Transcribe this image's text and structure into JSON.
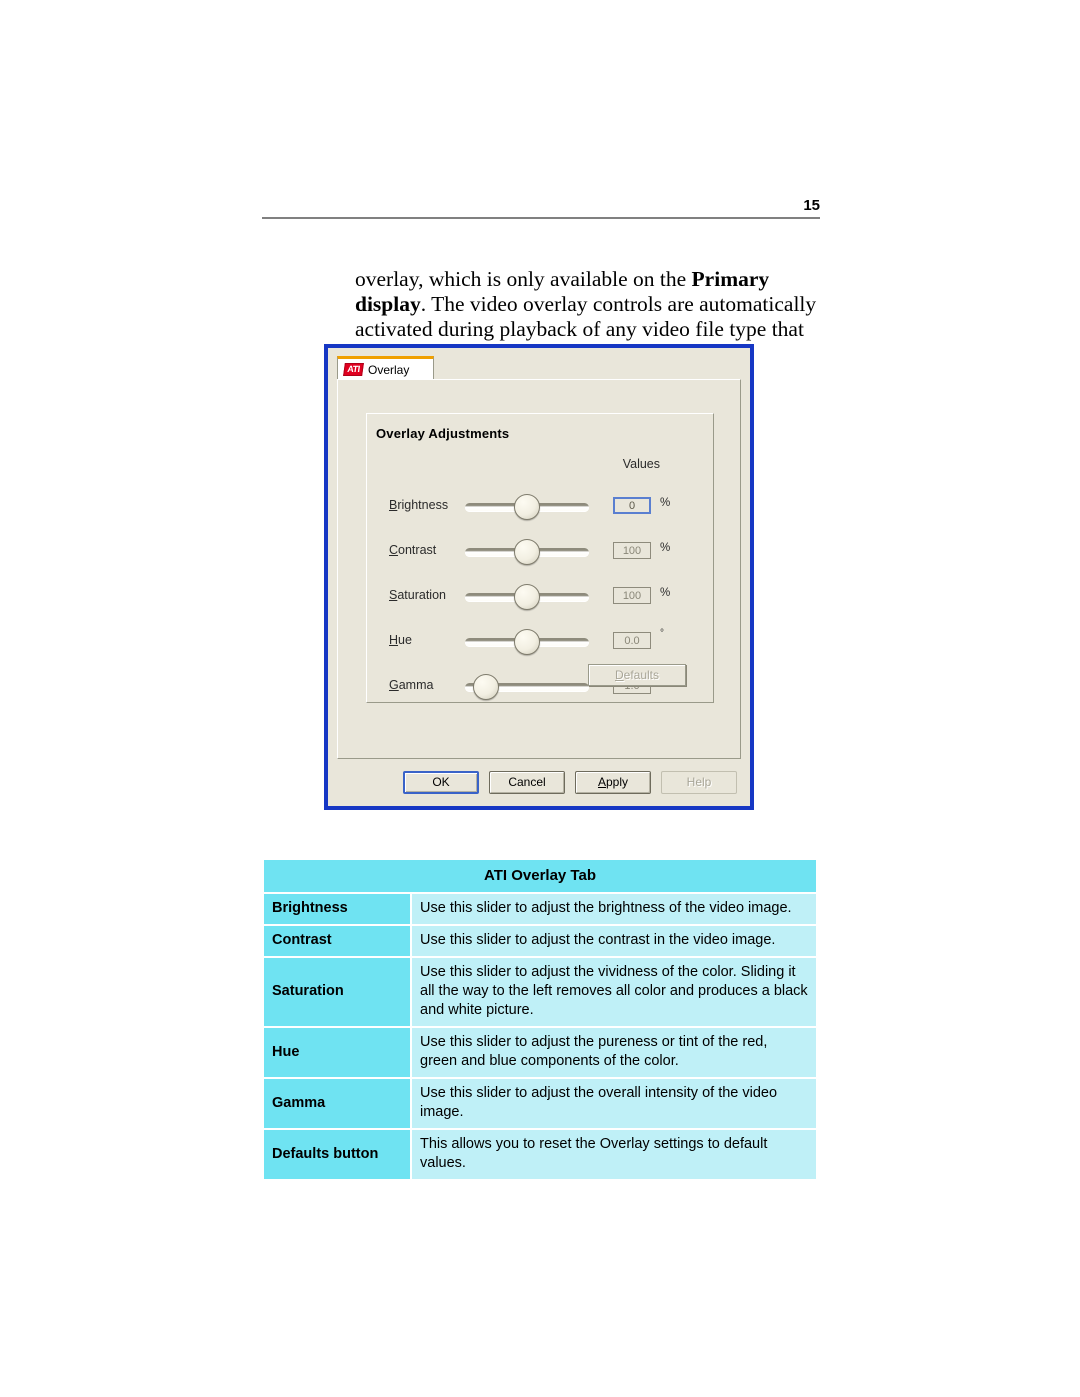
{
  "page": {
    "number": "15",
    "paragraph_part1": "overlay, which is only available on the ",
    "paragraph_bold": "Primary display",
    "paragraph_part2": ". The video overlay controls are automatically activated during playback of any video file type that supports overlay adjustments."
  },
  "dialog": {
    "tab": {
      "label": "Overlay",
      "logo_text": "ATI"
    },
    "group": {
      "title": "Overlay Adjustments",
      "values_header": "Values"
    },
    "sliders": [
      {
        "label_accel": "B",
        "label_rest": "rightness",
        "value": "0",
        "unit": "%",
        "thumb_percent": 50,
        "focused": true
      },
      {
        "label_accel": "C",
        "label_rest": "ontrast",
        "value": "100",
        "unit": "%",
        "thumb_percent": 50,
        "focused": false
      },
      {
        "label_accel": "S",
        "label_rest": "aturation",
        "value": "100",
        "unit": "%",
        "thumb_percent": 50,
        "focused": false
      },
      {
        "label_accel": "H",
        "label_rest": "ue",
        "value": "0.0",
        "unit": "°",
        "thumb_percent": 50,
        "focused": false
      },
      {
        "label_accel": "G",
        "label_rest": "amma",
        "value": "1.0",
        "unit": "",
        "thumb_percent": 8,
        "focused": false
      }
    ],
    "defaults_button": {
      "accel": "D",
      "rest": "efaults",
      "disabled": true
    },
    "buttons": [
      {
        "label": "OK",
        "accel": "",
        "rest": "OK",
        "state": "default"
      },
      {
        "label": "Cancel",
        "accel": "",
        "rest": "Cancel",
        "state": "normal"
      },
      {
        "label": "Apply",
        "accel": "A",
        "rest": "pply",
        "state": "normal"
      },
      {
        "label": "Help",
        "accel": "",
        "rest": "Help",
        "state": "disabled"
      }
    ]
  },
  "reference_table": {
    "title": "ATI Overlay Tab",
    "rows": [
      {
        "term": "Brightness",
        "description": "Use this slider to adjust the brightness of the video image."
      },
      {
        "term": "Contrast",
        "description": "Use this slider to adjust the contrast in the video image."
      },
      {
        "term": "Saturation",
        "description": "Use this slider to adjust the vividness of the color. Sliding it all the way to the left removes all color and produces a black and white picture."
      },
      {
        "term": "Hue",
        "description": "Use this slider to adjust the pureness or tint of the red, green and blue components of the color."
      },
      {
        "term": "Gamma",
        "description": "Use this slider to adjust the overall intensity of the video image."
      },
      {
        "term": "Defaults button",
        "description": "This allows you to reset the Overlay settings to default values."
      }
    ]
  },
  "colors": {
    "dialog_border": "#1637c4",
    "dialog_face": "#e9e6da",
    "tab_top_accent": "#f0a000",
    "ati_red": "#e00020",
    "table_term_bg": "#6fe3f2",
    "table_desc_bg": "#bff0f7",
    "focus_blue": "#3a63c8"
  }
}
